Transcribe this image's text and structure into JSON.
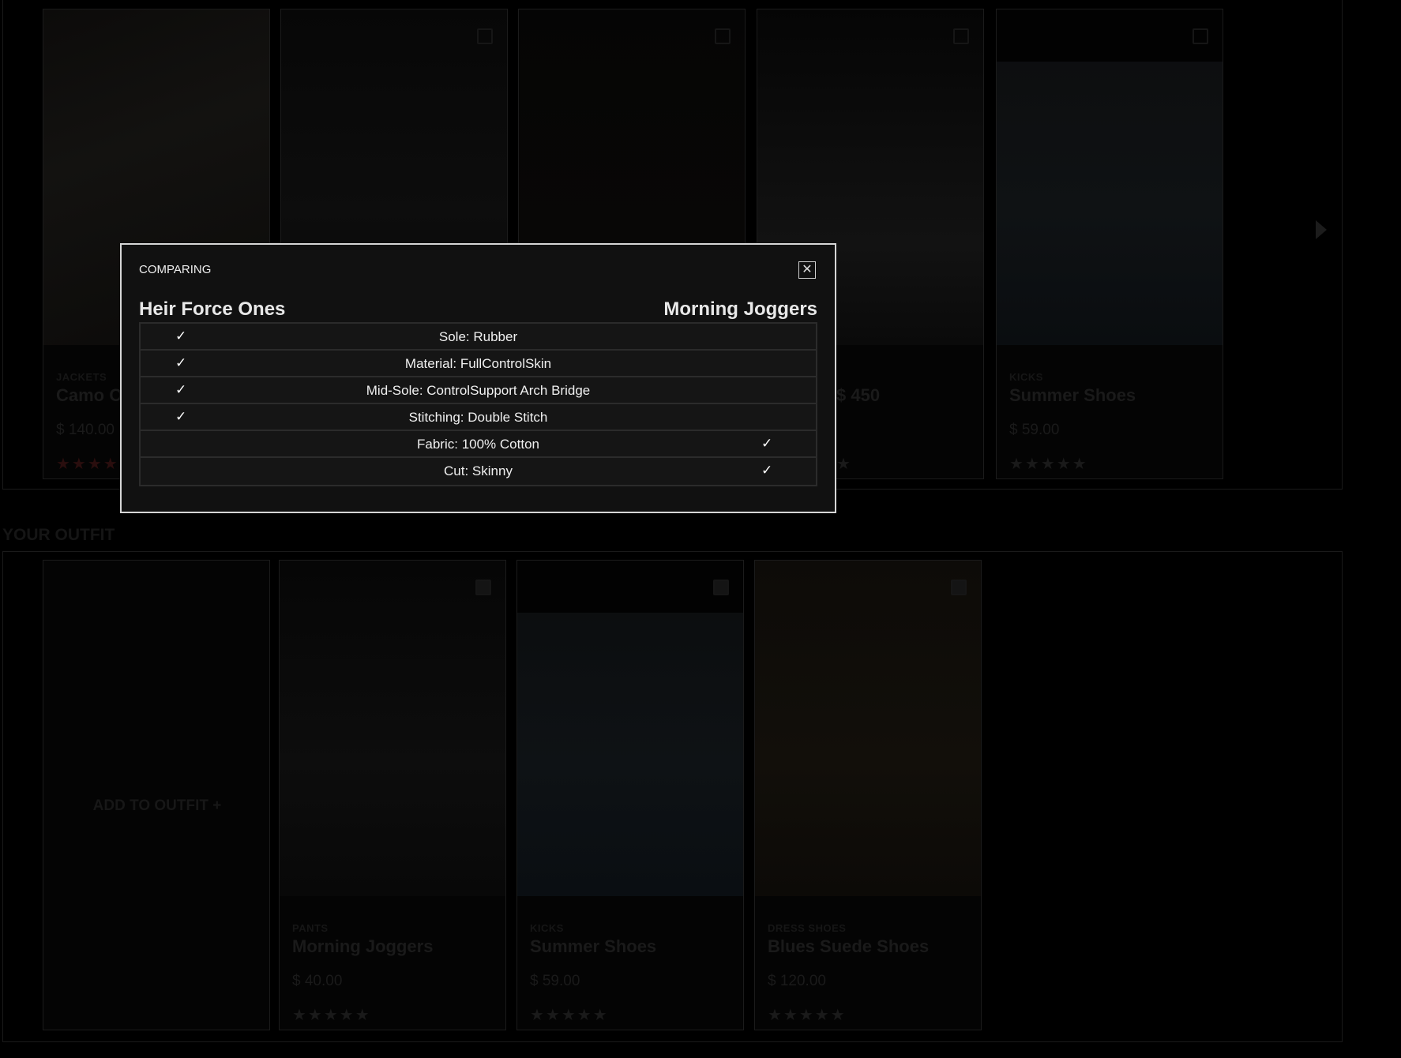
{
  "related": {
    "cards": [
      {
        "category": "JACKETS",
        "name": "Camo Onesie",
        "price": "$ 140.00",
        "stars": "★★★★★"
      },
      {
        "category": "",
        "name": "",
        "price": "",
        "stars": ""
      },
      {
        "category": "",
        "name": "",
        "price": "",
        "stars": ""
      },
      {
        "category": "",
        "name": "$ 450",
        "price": "",
        "stars": "★"
      },
      {
        "category": "KICKS",
        "name": "Summer Shoes",
        "price": "$ 59.00",
        "stars": "★★★★★"
      }
    ]
  },
  "outfit": {
    "title": "YOUR OUTFIT",
    "add_label": "ADD TO OUTFIT  +",
    "cards": [
      {
        "category": "PANTS",
        "name": "Morning Joggers",
        "price": "$ 40.00",
        "stars": "★★★★★"
      },
      {
        "category": "KICKS",
        "name": "Summer Shoes",
        "price": "$ 59.00",
        "stars": "★★★★★"
      },
      {
        "category": "DRESS SHOES",
        "name": "Blues Suede Shoes",
        "price": "$ 120.00",
        "stars": "★★★★★"
      }
    ]
  },
  "modal": {
    "label": "COMPARING",
    "close_symbol": "✕",
    "product_left": "Heir Force Ones",
    "product_right": "Morning Joggers",
    "check_symbol": "✓",
    "rows": [
      {
        "feature": "Sole: Rubber",
        "left": "✓",
        "right": ""
      },
      {
        "feature": "Material: FullControlSkin",
        "left": "✓",
        "right": ""
      },
      {
        "feature": "Mid-Sole: ControlSupport Arch Bridge",
        "left": "✓",
        "right": ""
      },
      {
        "feature": "Stitching: Double Stitch",
        "left": "✓",
        "right": ""
      },
      {
        "feature": "Fabric: 100% Cotton",
        "left": "",
        "right": "✓"
      },
      {
        "feature": "Cut: Skinny",
        "left": "",
        "right": "✓"
      }
    ]
  },
  "colors": {
    "overlay": "#000000",
    "modal_bg": "#111111",
    "modal_border": "#d6d6d6"
  }
}
